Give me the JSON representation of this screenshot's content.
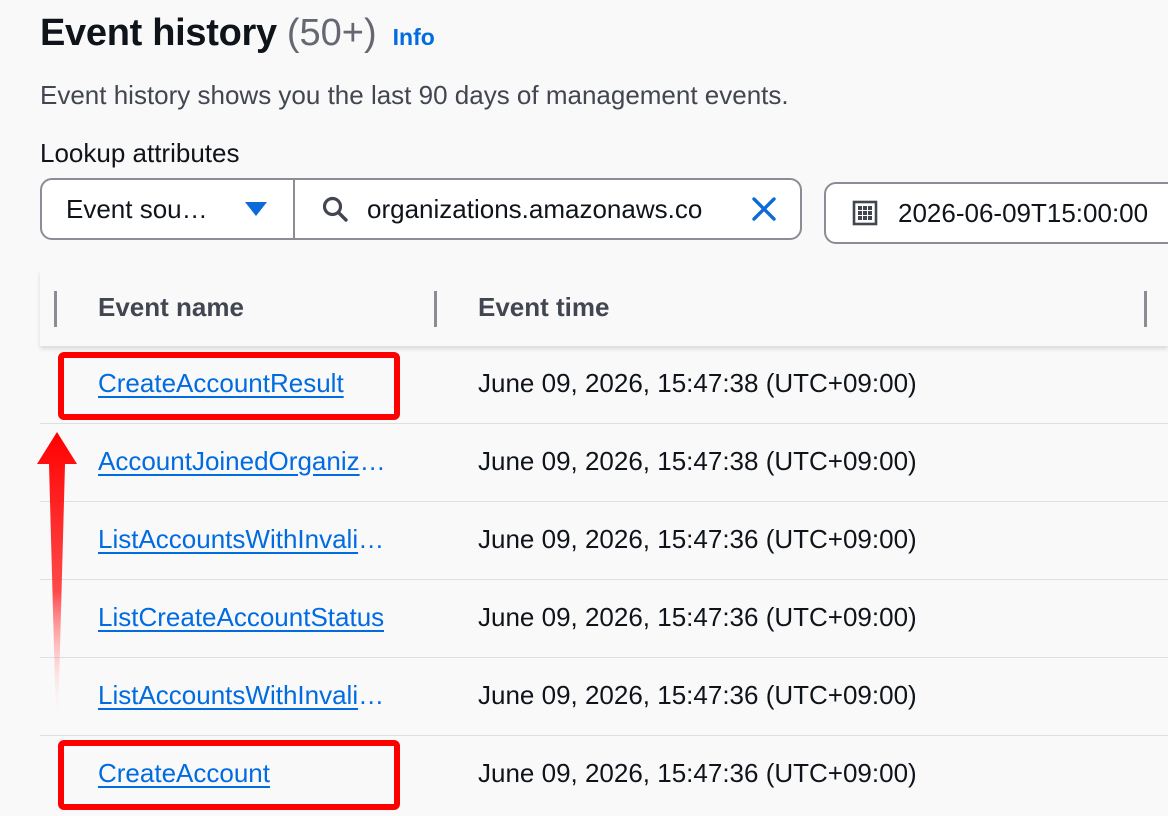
{
  "header": {
    "title": "Event history",
    "count": "(50+)",
    "info_link": "Info",
    "description": "Event history shows you the last 90 days of management events."
  },
  "lookup": {
    "label": "Lookup attributes",
    "attribute": "Event sou…",
    "search_value": "organizations.amazonaws.co",
    "date_value": "2026-06-09T15:00:00"
  },
  "table": {
    "columns": [
      "Event name",
      "Event time"
    ],
    "rows": [
      {
        "name": "CreateAccountResult",
        "time": "June 09, 2026, 15:47:38 (UTC+09:00)"
      },
      {
        "name": "AccountJoinedOrganization",
        "time": "June 09, 2026, 15:47:38 (UTC+09:00)"
      },
      {
        "name": "ListAccountsWithInvalidEffectivePolicy",
        "time": "June 09, 2026, 15:47:36 (UTC+09:00)"
      },
      {
        "name": "ListCreateAccountStatus",
        "time": "June 09, 2026, 15:47:36 (UTC+09:00)"
      },
      {
        "name": "ListAccountsWithInvalidEffectivePolicy",
        "time": "June 09, 2026, 15:47:36 (UTC+09:00)"
      },
      {
        "name": "CreateAccount",
        "time": "June 09, 2026, 15:47:36 (UTC+09:00)"
      }
    ]
  },
  "annotations": {
    "highlight_color": "#ff0000",
    "highlighted_rows": [
      "CreateAccountResult",
      "CreateAccount"
    ],
    "arrow": "upward arrow from CreateAccount to CreateAccountResult"
  },
  "colors": {
    "link": "#006ce0",
    "caret": "#0b6bd8",
    "text": "#0f141a",
    "muted": "#424650",
    "background": "#f9f9fa"
  }
}
